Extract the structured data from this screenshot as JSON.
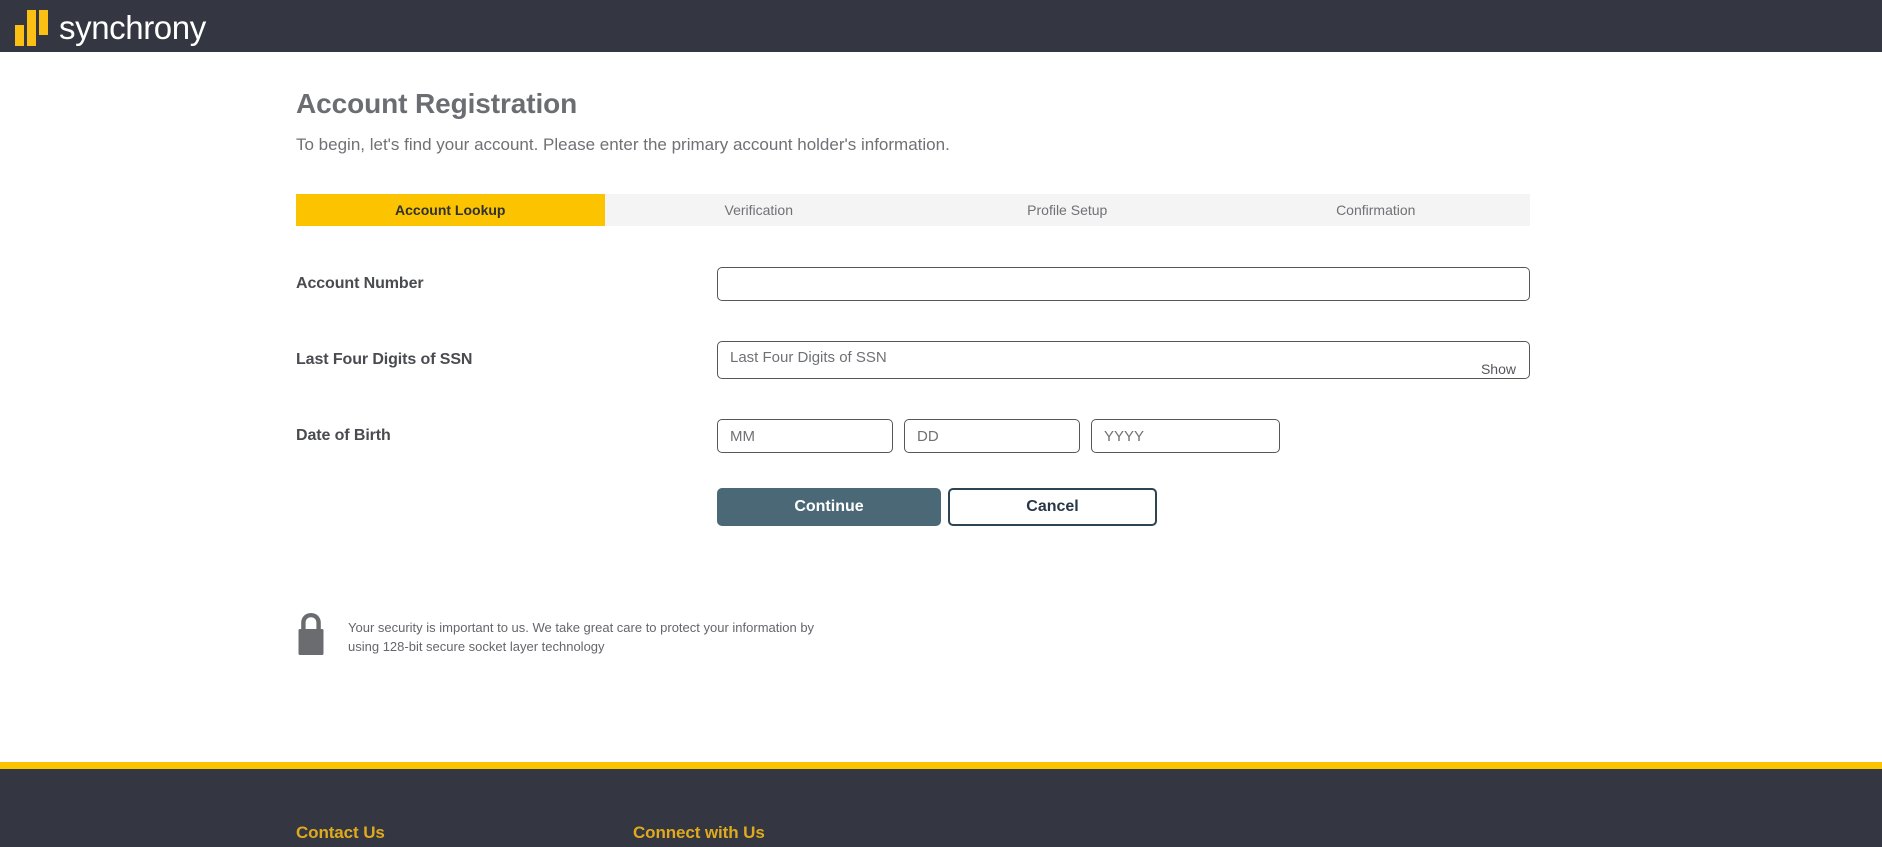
{
  "header": {
    "brand_name": "synchrony",
    "logo_color": "#fcc015",
    "background": "#343741"
  },
  "main": {
    "title": "Account Registration",
    "subtitle": "To begin, let's find your account. Please enter the primary account holder's information.",
    "steps": [
      {
        "label": "Account Lookup",
        "active": true
      },
      {
        "label": "Verification",
        "active": false
      },
      {
        "label": "Profile Setup",
        "active": false
      },
      {
        "label": "Confirmation",
        "active": false
      }
    ],
    "active_step_color": "#fbc300",
    "fields": {
      "account_number": {
        "label": "Account Number",
        "value": "",
        "placeholder": ""
      },
      "ssn": {
        "label": "Last Four Digits of SSN",
        "value": "",
        "placeholder": "Last Four Digits of SSN",
        "show_label": "Show"
      },
      "dob": {
        "label": "Date of Birth",
        "month": {
          "value": "",
          "placeholder": "MM"
        },
        "day": {
          "value": "",
          "placeholder": "DD"
        },
        "year": {
          "value": "",
          "placeholder": "YYYY"
        }
      }
    },
    "buttons": {
      "continue_label": "Continue",
      "continue_color": "#4b6877",
      "cancel_label": "Cancel",
      "cancel_border_color": "#2d4454"
    },
    "security": {
      "icon": "lock-icon",
      "line1": "Your security is important to us. We take great care to protect your information by",
      "line2": "using 128-bit secure socket layer technology"
    }
  },
  "footer": {
    "accent_color": "#fbc300",
    "background": "#343741",
    "columns": [
      {
        "heading": "Contact Us"
      },
      {
        "heading": "Connect with Us"
      }
    ]
  }
}
